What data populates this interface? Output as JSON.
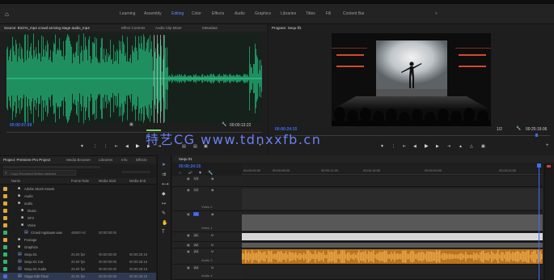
{
  "workspace": {
    "tabs": [
      "Learning",
      "Assembly",
      "Editing",
      "Color",
      "Effects",
      "Audio",
      "Graphics",
      "Libraries",
      "Titles",
      "Fill",
      "Content Bar"
    ],
    "active_index": 2,
    "extra": "»"
  },
  "source": {
    "tabs": [
      "Source: Bird-N_mp4 crowd arriving stage audio_mp4",
      "Effect Controls",
      "Audio Clip Mixer",
      "Metadata"
    ],
    "timecode_left": "00:00:07:09",
    "timecode_right": "00:00:13:22"
  },
  "program": {
    "tab": "Program: Sequ 01",
    "timecode_left": "00:00:24:15",
    "timecode_right": "00:25:19:06",
    "fit": "1/2"
  },
  "watermark": "特艺CG   www.tdnxxfb.cn",
  "project": {
    "tabs": [
      "Project: Premiere Pro Project",
      "Media Browser",
      "Libraries",
      "Info",
      "Effects"
    ],
    "search_placeholder": "Copy Recorded Motion cleaned",
    "columns": [
      "Name",
      "Frame Rate",
      "Media Start",
      "Media End"
    ],
    "rows": [
      {
        "name": "Adobe Stock Assets",
        "frame": "",
        "start": "",
        "end": "",
        "color": "#e0a83a"
      },
      {
        "name": "Audio",
        "frame": "",
        "start": "",
        "end": "",
        "color": "#e0a83a"
      },
      {
        "name": "audio",
        "frame": "",
        "start": "",
        "end": "",
        "color": "#e0a83a"
      },
      {
        "name": "Music",
        "frame": "",
        "start": "",
        "end": "",
        "color": "#e0a83a"
      },
      {
        "name": "SFX",
        "frame": "",
        "start": "",
        "end": "",
        "color": "#e0a83a"
      },
      {
        "name": "Voice",
        "frame": "",
        "start": "",
        "end": "",
        "color": "#e0a83a"
      },
      {
        "name": "Crowd Applause.wav",
        "frame": "48000 Hz",
        "start": "00:00:00:00",
        "end": "",
        "color": "#2fb572"
      },
      {
        "name": "Footage",
        "frame": "",
        "start": "",
        "end": "",
        "color": "#e0a83a"
      },
      {
        "name": "Graphics",
        "frame": "",
        "start": "",
        "end": "",
        "color": "#2fb572"
      },
      {
        "name": "Sequ 01",
        "frame": "25.00 fps",
        "start": "00:00:00:00",
        "end": "00:00:25:19",
        "color": "#2fb572"
      },
      {
        "name": "Sequ 01 Cut",
        "frame": "25.00 fps",
        "start": "00:00:00:00",
        "end": "00:00:25:19",
        "color": "#2fb572"
      },
      {
        "name": "Sequ 01 Audio",
        "frame": "25.00 fps",
        "start": "00:00:00:00",
        "end": "00:00:25:19",
        "color": "#2fb572"
      },
      {
        "name": "Stage Edit Final",
        "frame": "25.00 fps",
        "start": "00:00:00:00",
        "end": "00:00:25:19",
        "color": "#4a6cd8"
      }
    ]
  },
  "timeline": {
    "tab": "Sequ 01",
    "timecode": "00:00:24:15",
    "ruler": [
      "00:00:04:00",
      "00:00:08:00",
      "00:00:12:00",
      "00:00:16:00",
      "00:00:20:00",
      "00:00:24:00"
    ],
    "tracks": [
      {
        "id": "V3",
        "label": "Video 3"
      },
      {
        "id": "V2",
        "label": "Video 2"
      },
      {
        "id": "V1",
        "label": "Video 1"
      },
      {
        "id": "A1",
        "label": "Audio 1"
      },
      {
        "id": "A2",
        "label": "Audio 2"
      },
      {
        "id": "A3",
        "label": "Audio 3"
      },
      {
        "id": "A4",
        "label": "Audio 4"
      }
    ]
  },
  "colors": {
    "accent": "#3d6ff5",
    "waveform": "#1f8f5f",
    "audio_clip": "#d98b2a",
    "playhead": "#3d6ff5"
  }
}
